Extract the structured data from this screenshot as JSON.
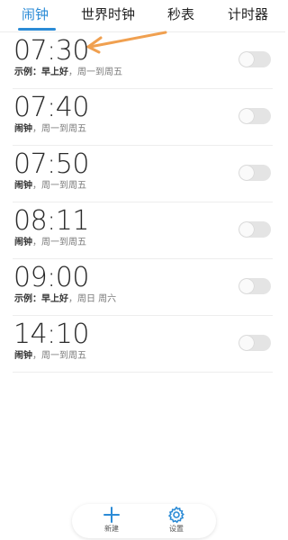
{
  "tabs": [
    {
      "label": "闹钟",
      "active": true
    },
    {
      "label": "世界时钟",
      "active": false
    },
    {
      "label": "秒表",
      "active": false
    },
    {
      "label": "计时器",
      "active": false
    }
  ],
  "alarms": [
    {
      "time": "07:30",
      "label": "示例：早上好",
      "repeat": "，周一到周五",
      "enabled": false
    },
    {
      "time": "07:40",
      "label": "闹钟",
      "repeat": "，周一到周五",
      "enabled": false
    },
    {
      "time": "07:50",
      "label": "闹钟",
      "repeat": "，周一到周五",
      "enabled": false
    },
    {
      "time": "08:11",
      "label": "闹钟",
      "repeat": "，周一到周五",
      "enabled": false
    },
    {
      "time": "09:00",
      "label": "示例：早上好",
      "repeat": "，周日 周六",
      "enabled": false
    },
    {
      "time": "14:10",
      "label": "闹钟",
      "repeat": "，周一到周五",
      "enabled": false
    }
  ],
  "bottom_bar": {
    "add": {
      "label": "新建",
      "icon": "plus-icon"
    },
    "settings": {
      "label": "设置",
      "icon": "gear-icon"
    }
  },
  "colors": {
    "accent": "#2b8bd6",
    "annotation_arrow": "#f0a050",
    "toggle_off": "#e4e4e4"
  }
}
